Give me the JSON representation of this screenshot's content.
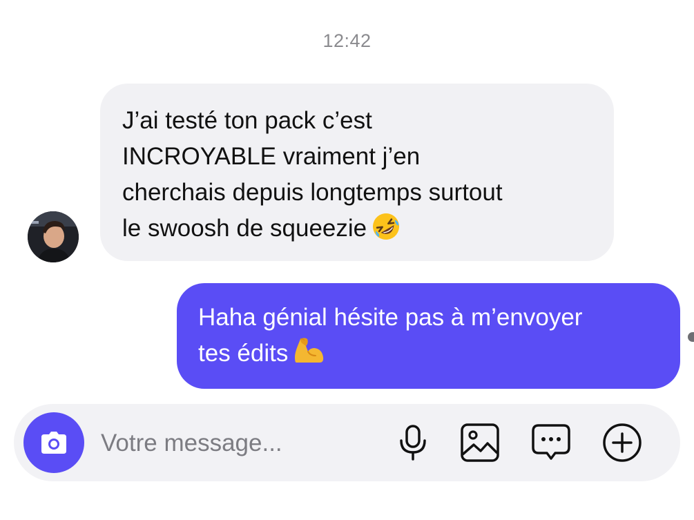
{
  "conversation": {
    "timestamp": "12:42",
    "messages": [
      {
        "direction": "incoming",
        "lines": [
          "J’ai testé ton pack c’est",
          "INCROYABLE vraiment j’en",
          "cherchais depuis longtemps surtout",
          "le swoosh de squeezie"
        ],
        "emoji": "rolling-on-floor-laughing"
      },
      {
        "direction": "outgoing",
        "lines": [
          "Haha génial hésite pas à m’envoyer",
          "tes édits"
        ],
        "emoji": "flexed-biceps"
      }
    ]
  },
  "composer": {
    "placeholder": "Votre message...",
    "icons": [
      "camera-icon",
      "microphone-icon",
      "image-icon",
      "chat-bubble-dots-icon",
      "plus-circle-icon"
    ]
  },
  "colors": {
    "accent": "#5a4df5",
    "incoming_bubble": "#f1f1f4",
    "outgoing_text": "#ffffff",
    "timestamp": "#8a8a8e",
    "composer_bg": "#f2f2f5"
  }
}
